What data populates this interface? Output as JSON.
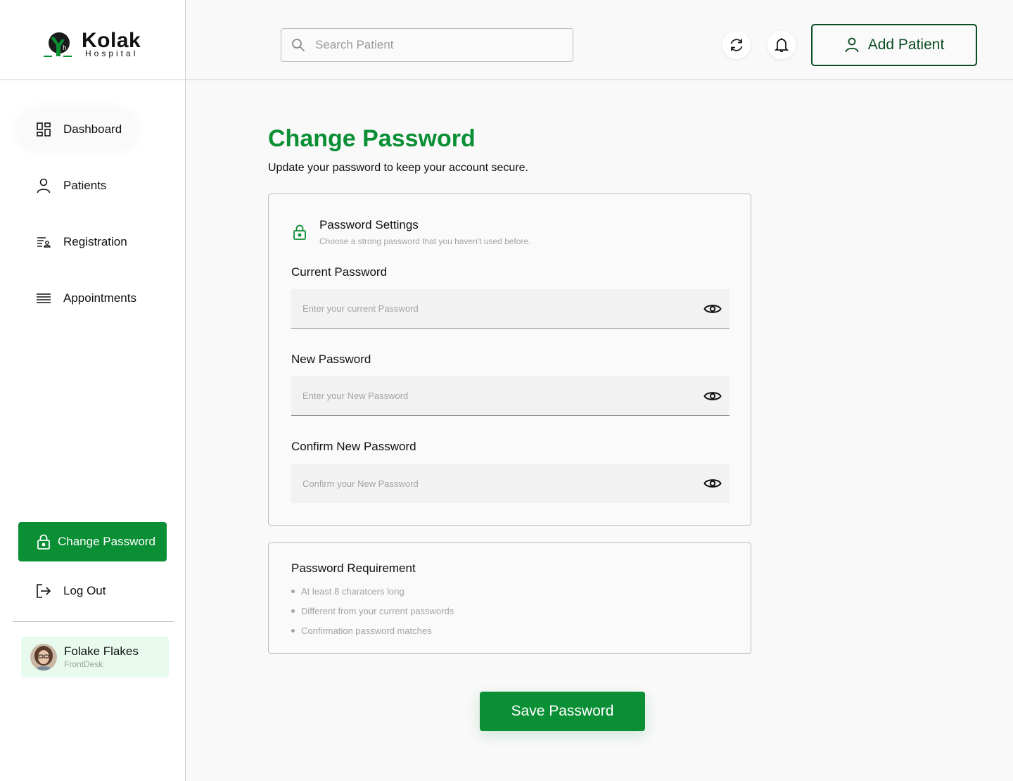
{
  "brand": {
    "name": "Kolak",
    "sub": "Hospital",
    "accent": "#0a8f35",
    "dark_accent": "#0b4d22"
  },
  "sidebar": {
    "items": [
      {
        "label": "Dashboard",
        "icon": "dashboard-grid-icon"
      },
      {
        "label": "Patients",
        "icon": "user-icon"
      },
      {
        "label": "Registration",
        "icon": "registration-list-icon"
      },
      {
        "label": "Appointments",
        "icon": "list-lines-icon"
      }
    ],
    "change_password": {
      "label": "Change Password",
      "icon": "lock-icon",
      "active": true
    },
    "logout": {
      "label": "Log Out",
      "icon": "logout-icon"
    },
    "user": {
      "name": "Folake Flakes",
      "role": "FrontDesk"
    }
  },
  "header": {
    "search_placeholder": "Search Patient",
    "add_patient_label": "Add Patient",
    "icons": [
      "search-icon",
      "refresh-icon",
      "bell-icon",
      "user-plus-icon"
    ]
  },
  "page": {
    "title": "Change Password",
    "subtitle": "Update your password to keep your account secure."
  },
  "settings": {
    "title": "Password Settings",
    "subtitle": "Choose a strong password that you haven't used before.",
    "fields": [
      {
        "label": "Current Password",
        "placeholder": "Enter your current Password"
      },
      {
        "label": "New Password",
        "placeholder": "Enter your New Password"
      },
      {
        "label": "Confirm New Password",
        "placeholder": "Confirm your New Password"
      }
    ]
  },
  "requirements": {
    "title": "Password Requirement",
    "items": [
      "At least 8 charatcers long",
      "Different from your current passwords",
      "Confirmation password matches"
    ]
  },
  "save_label": "Save Password"
}
